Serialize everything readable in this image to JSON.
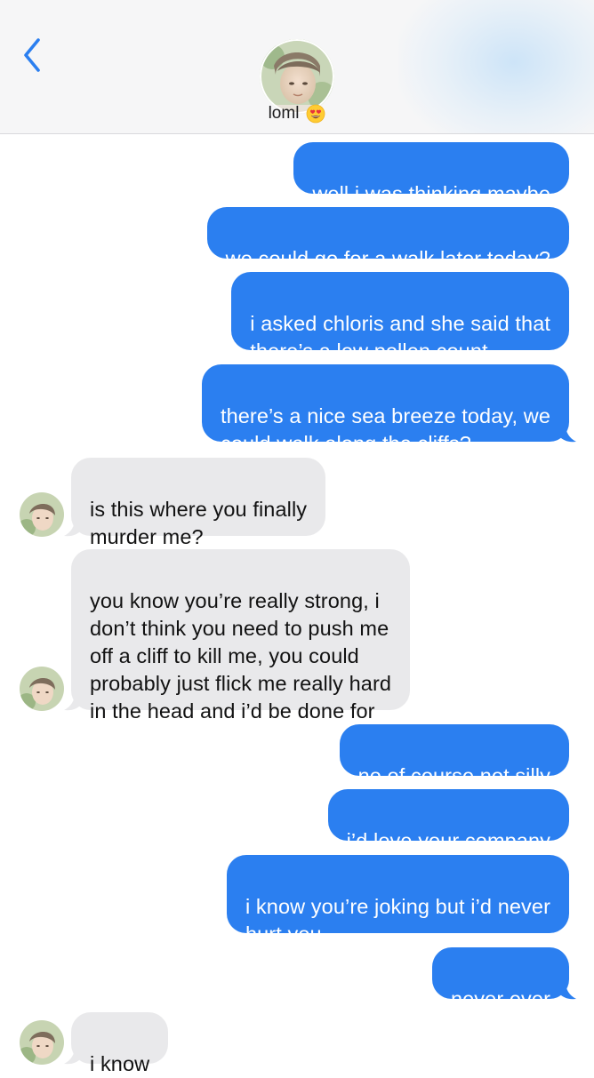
{
  "header": {
    "back_icon": "chevron-left-icon",
    "contact_name": "loml",
    "contact_emoji": "heart-eyes-emoji-icon",
    "accent_color": "#2b7ff0"
  },
  "messages": [
    {
      "side": "sent",
      "text": "well i was thinking maybe"
    },
    {
      "side": "sent",
      "text": "we could go for a walk later today?"
    },
    {
      "side": "sent",
      "text": "i asked chloris and she said that\nthere’s a low pollen count"
    },
    {
      "side": "sent",
      "text": "there’s a nice sea breeze today, we\ncould walk along the cliffs?"
    },
    {
      "side": "received",
      "text": "is this where you finally\nmurder me?"
    },
    {
      "side": "received",
      "text": "you know you’re really strong, i\ndon’t think you need to push me\noff a cliff to kill me, you could\nprobably just flick me really hard\nin the head and i’d be done for"
    },
    {
      "side": "sent",
      "text": "no of course not silly"
    },
    {
      "side": "sent",
      "text": "i’d love your company"
    },
    {
      "side": "sent",
      "text": "i know you’re joking but i’d never\nhurt you"
    },
    {
      "side": "sent",
      "text": "never ever"
    },
    {
      "side": "received",
      "text": "i know"
    }
  ]
}
